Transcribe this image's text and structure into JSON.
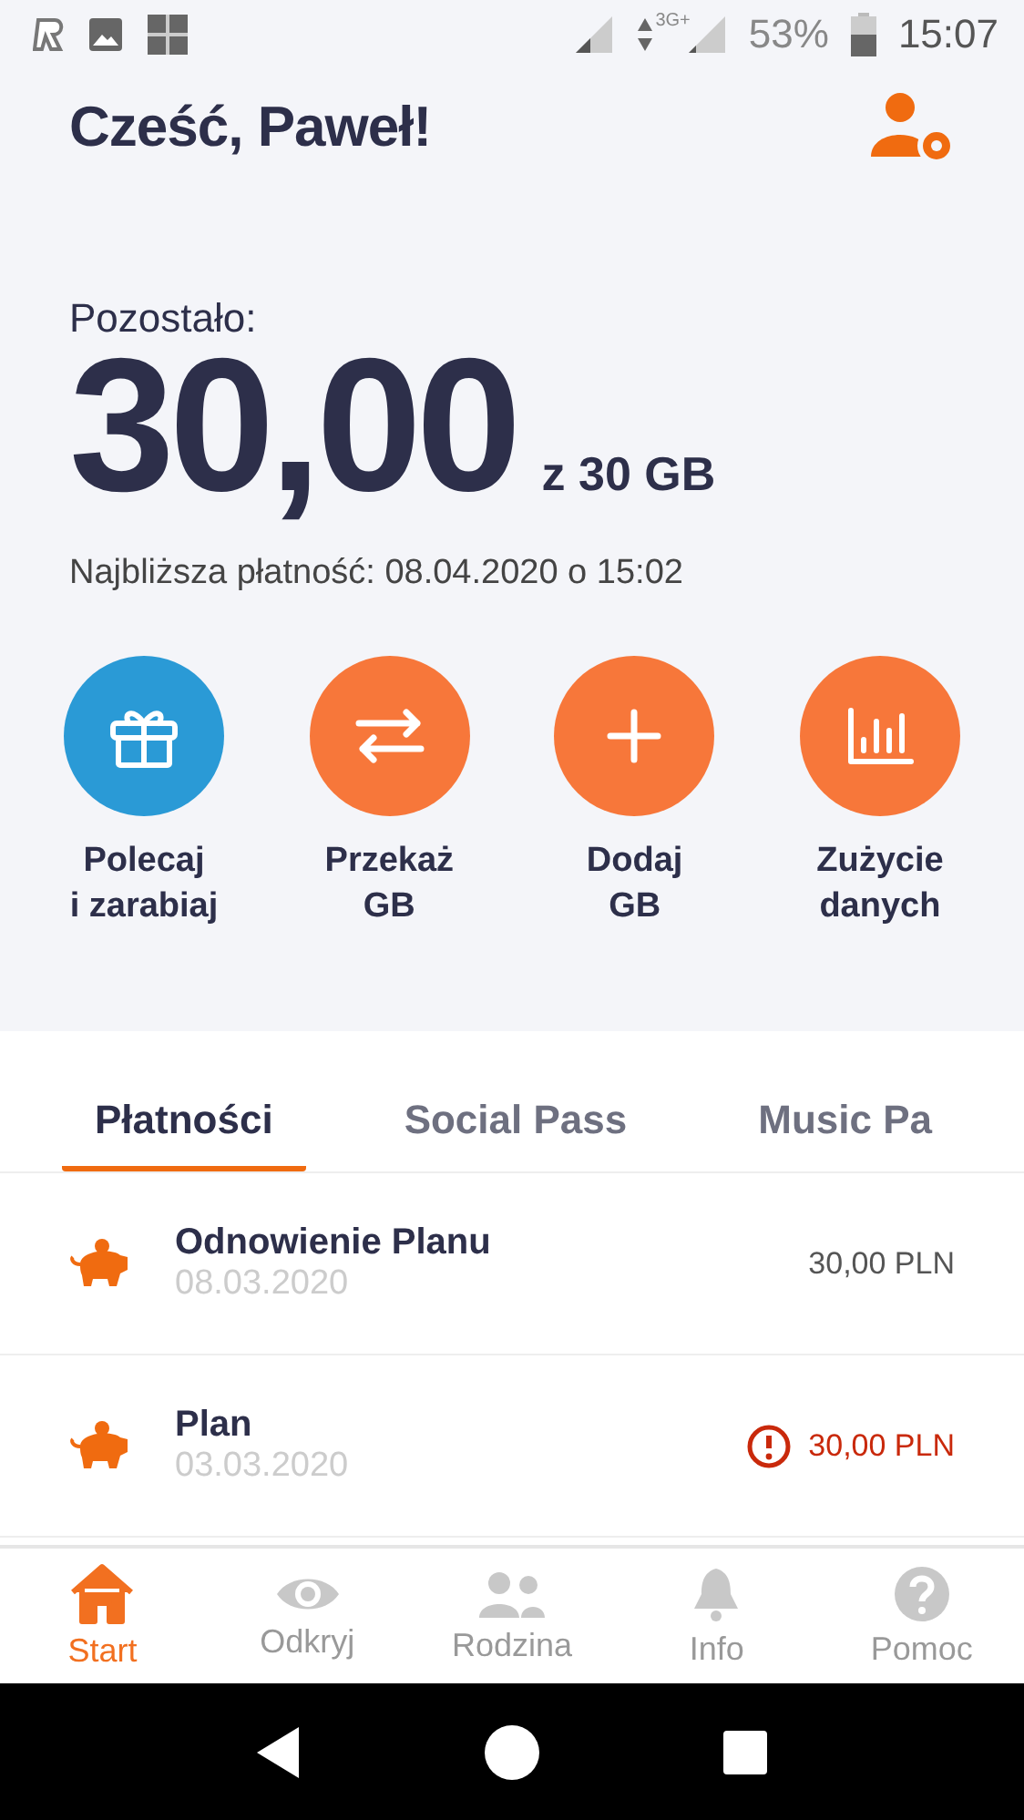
{
  "status_bar": {
    "network": "3G+",
    "battery": "53%",
    "time": "15:07"
  },
  "greeting": "Cześć, Paweł!",
  "balance": {
    "label": "Pozostało:",
    "amount": "30,00",
    "total": "z 30 GB",
    "next_payment": "Najbliższa płatność: 08.04.2020 o 15:02"
  },
  "actions": [
    {
      "kind": "gift",
      "label": [
        "Polecaj",
        "i zarabiaj"
      ],
      "color": "#2a9ad6"
    },
    {
      "kind": "transfer",
      "label": [
        "Przekaż",
        "GB"
      ],
      "color": "#f7773a"
    },
    {
      "kind": "add",
      "label": [
        "Dodaj",
        "GB"
      ],
      "color": "#f7773a"
    },
    {
      "kind": "usage",
      "label": [
        "Zużycie",
        "danych"
      ],
      "color": "#f7773a"
    }
  ],
  "tabs": [
    {
      "label": "Płatności",
      "selected": true
    },
    {
      "label": "Social Pass",
      "selected": false
    },
    {
      "label": "Music Pa",
      "selected": false
    }
  ],
  "payments": [
    {
      "title": "Odnowienie Planu",
      "date": "08.03.2020",
      "amount": "30,00 PLN",
      "overdue": false
    },
    {
      "title": "Plan",
      "date": "03.03.2020",
      "amount": "30,00 PLN",
      "overdue": true
    }
  ],
  "bottom_nav": [
    {
      "kind": "home",
      "label": "Start",
      "selected": true
    },
    {
      "kind": "eye",
      "label": "Odkryj",
      "selected": false
    },
    {
      "kind": "people",
      "label": "Rodzina",
      "selected": false
    },
    {
      "kind": "bell",
      "label": "Info",
      "selected": false
    },
    {
      "kind": "help",
      "label": "Pomoc",
      "selected": false
    }
  ]
}
